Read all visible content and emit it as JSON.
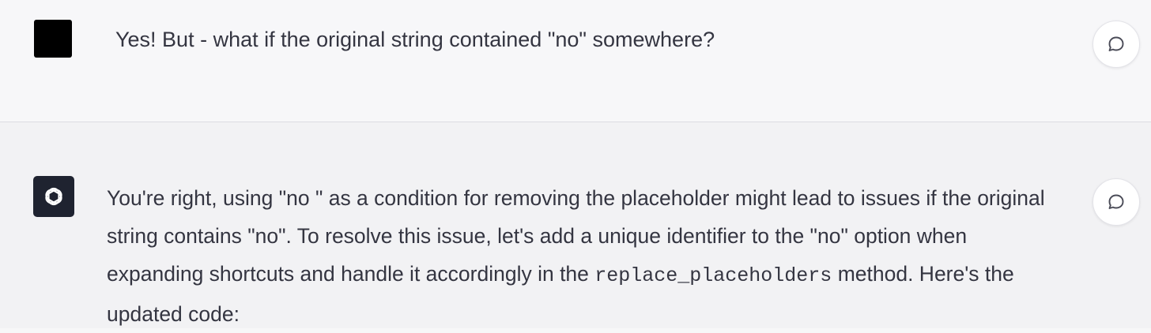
{
  "user_message": {
    "text": "Yes! But - what if the original string contained \"no\" somewhere?"
  },
  "assistant_message": {
    "line1": "You're right, using \"no \" as a condition for removing the placeholder might lead to issues if the original",
    "line2": "string contains \"no\". To resolve this issue, let's add a unique identifier to the \"no\" option when",
    "line3_before": "expanding shortcuts and handle it accordingly in the ",
    "line3_code": "replace_placeholders",
    "line3_after": " method. Here's the",
    "line4": "updated code:"
  },
  "icons": {
    "user_avatar": "user-avatar",
    "assistant_avatar": "openai-logo-icon",
    "comment": "speech-bubble-icon"
  },
  "colors": {
    "user_row_bg": "#f7f7f9",
    "assistant_row_bg": "#f2f2f4",
    "text": "#343541",
    "assistant_avatar_bg": "#1f2330"
  }
}
